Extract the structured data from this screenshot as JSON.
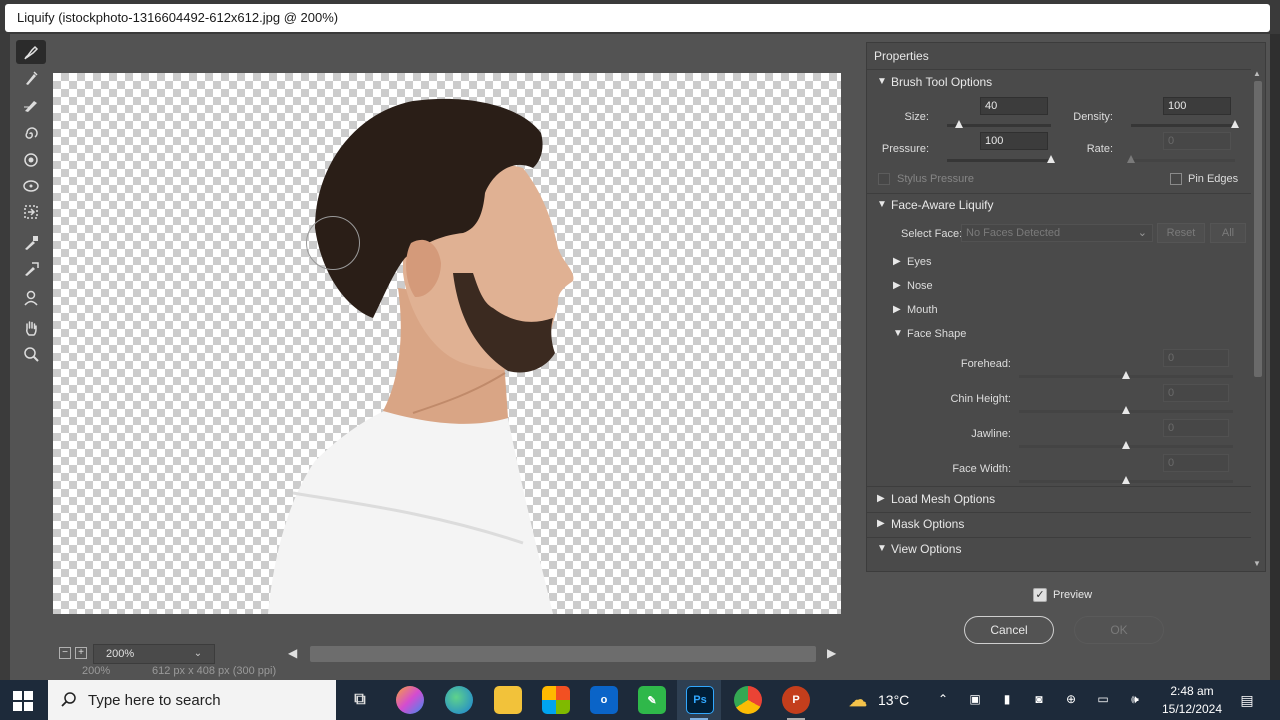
{
  "window": {
    "title": "Liquify (istockphoto-1316604492-612x612.jpg @ 200%)"
  },
  "tools": [
    "forward-warp-icon",
    "reconstruct-icon",
    "smooth-icon",
    "twirl-icon",
    "pucker-icon",
    "bloat-icon",
    "push-left-icon",
    "freeze-mask-icon",
    "thaw-mask-icon",
    "face-tool-icon",
    "hand-icon",
    "zoom-icon"
  ],
  "canvas_bar": {
    "zoom": "200%",
    "behind_zoom": "200%",
    "behind_size": "612 px x 408 px (300 ppi)"
  },
  "properties": {
    "title": "Properties",
    "brush": {
      "header": "Brush Tool Options",
      "size_label": "Size:",
      "size_value": "40",
      "size_level": 0.12,
      "density_label": "Density:",
      "density_value": "100",
      "density_level": 1.0,
      "pressure_label": "Pressure:",
      "pressure_value": "100",
      "pressure_level": 1.0,
      "rate_label": "Rate:",
      "rate_value": "0",
      "rate_level": 0.0,
      "stylus_label": "Stylus Pressure",
      "pin_edges_label": "Pin Edges"
    },
    "face": {
      "header": "Face-Aware Liquify",
      "select_face_label": "Select Face:",
      "select_face_value": "No Faces Detected",
      "reset_label": "Reset",
      "all_label": "All",
      "eyes": "Eyes",
      "nose": "Nose",
      "mouth": "Mouth",
      "face_shape": "Face Shape",
      "forehead_label": "Forehead:",
      "forehead_value": "0",
      "chin_label": "Chin Height:",
      "chin_value": "0",
      "jawline_label": "Jawline:",
      "jawline_value": "0",
      "width_label": "Face Width:",
      "width_value": "0"
    },
    "load_mesh": "Load Mesh Options",
    "mask": "Mask Options",
    "view": "View Options"
  },
  "preview_label": "Preview",
  "cancel_label": "Cancel",
  "ok_label": "OK",
  "taskbar": {
    "search_placeholder": "Type here to search",
    "temperature": "13°C",
    "time": "2:48 am",
    "date": "15/12/2024",
    "ps_label": "Ps",
    "ppt_label": "P"
  }
}
